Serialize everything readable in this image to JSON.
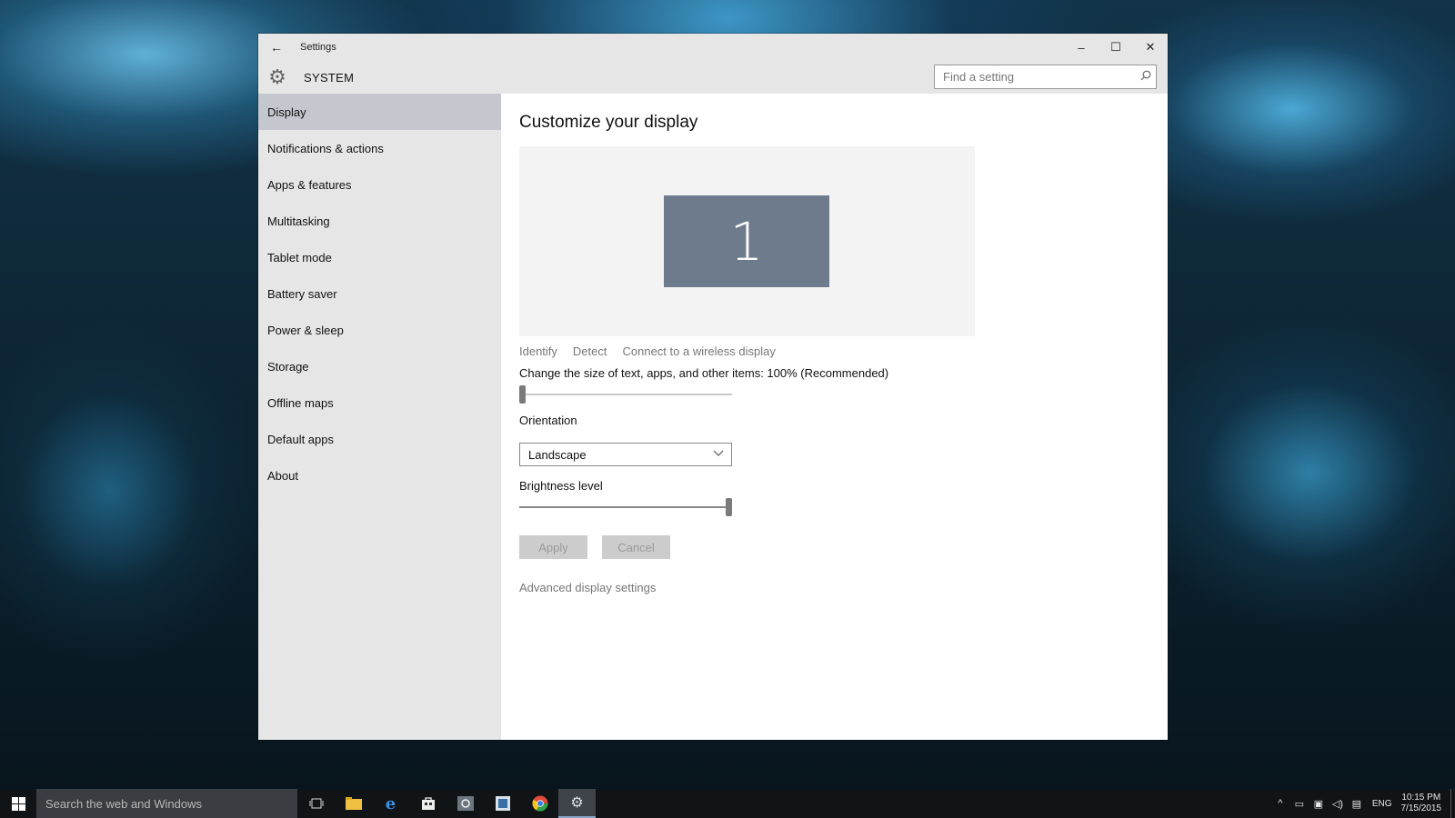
{
  "window": {
    "title": "Settings",
    "back_glyph": "←",
    "controls": {
      "minimize": "–",
      "maximize": "☐",
      "close": "✕"
    }
  },
  "header": {
    "title": "SYSTEM",
    "icon": "gear-icon",
    "search": {
      "placeholder": "Find a setting",
      "value": "",
      "icon": "search-icon"
    }
  },
  "sidebar": {
    "items": [
      {
        "label": "Display",
        "active": true
      },
      {
        "label": "Notifications & actions",
        "active": false
      },
      {
        "label": "Apps & features",
        "active": false
      },
      {
        "label": "Multitasking",
        "active": false
      },
      {
        "label": "Tablet mode",
        "active": false
      },
      {
        "label": "Battery saver",
        "active": false
      },
      {
        "label": "Power & sleep",
        "active": false
      },
      {
        "label": "Storage",
        "active": false
      },
      {
        "label": "Offline maps",
        "active": false
      },
      {
        "label": "Default apps",
        "active": false
      },
      {
        "label": "About",
        "active": false
      }
    ]
  },
  "content": {
    "title": "Customize your display",
    "monitor_number": "1",
    "display_links": {
      "identify": "Identify",
      "detect": "Detect",
      "wireless": "Connect to a wireless display"
    },
    "scale": {
      "label": "Change the size of text, apps, and other items: 100% (Recommended)",
      "level": 0.0
    },
    "orientation": {
      "label": "Orientation",
      "value": "Landscape"
    },
    "brightness": {
      "label": "Brightness level",
      "level": 1.0
    },
    "buttons": {
      "apply": "Apply",
      "cancel": "Cancel"
    },
    "advanced_link": "Advanced display settings"
  },
  "taskbar": {
    "search_placeholder": "Search the web and Windows",
    "apps": [
      "task-view-icon",
      "file-explorer-icon",
      "edge-icon",
      "store-icon",
      "media-app-icon",
      "settings-app-icon",
      "chrome-icon",
      "settings-icon"
    ],
    "tray": {
      "language": "ENG",
      "time": "10:15 PM",
      "date": "7/15/2015"
    }
  },
  "colors": {
    "accent_active_nav": "#c4c8ce",
    "chrome_bg": "#e6e6e6",
    "monitor_tile": "#6d7b8d",
    "taskbar_bg": "#101417"
  }
}
